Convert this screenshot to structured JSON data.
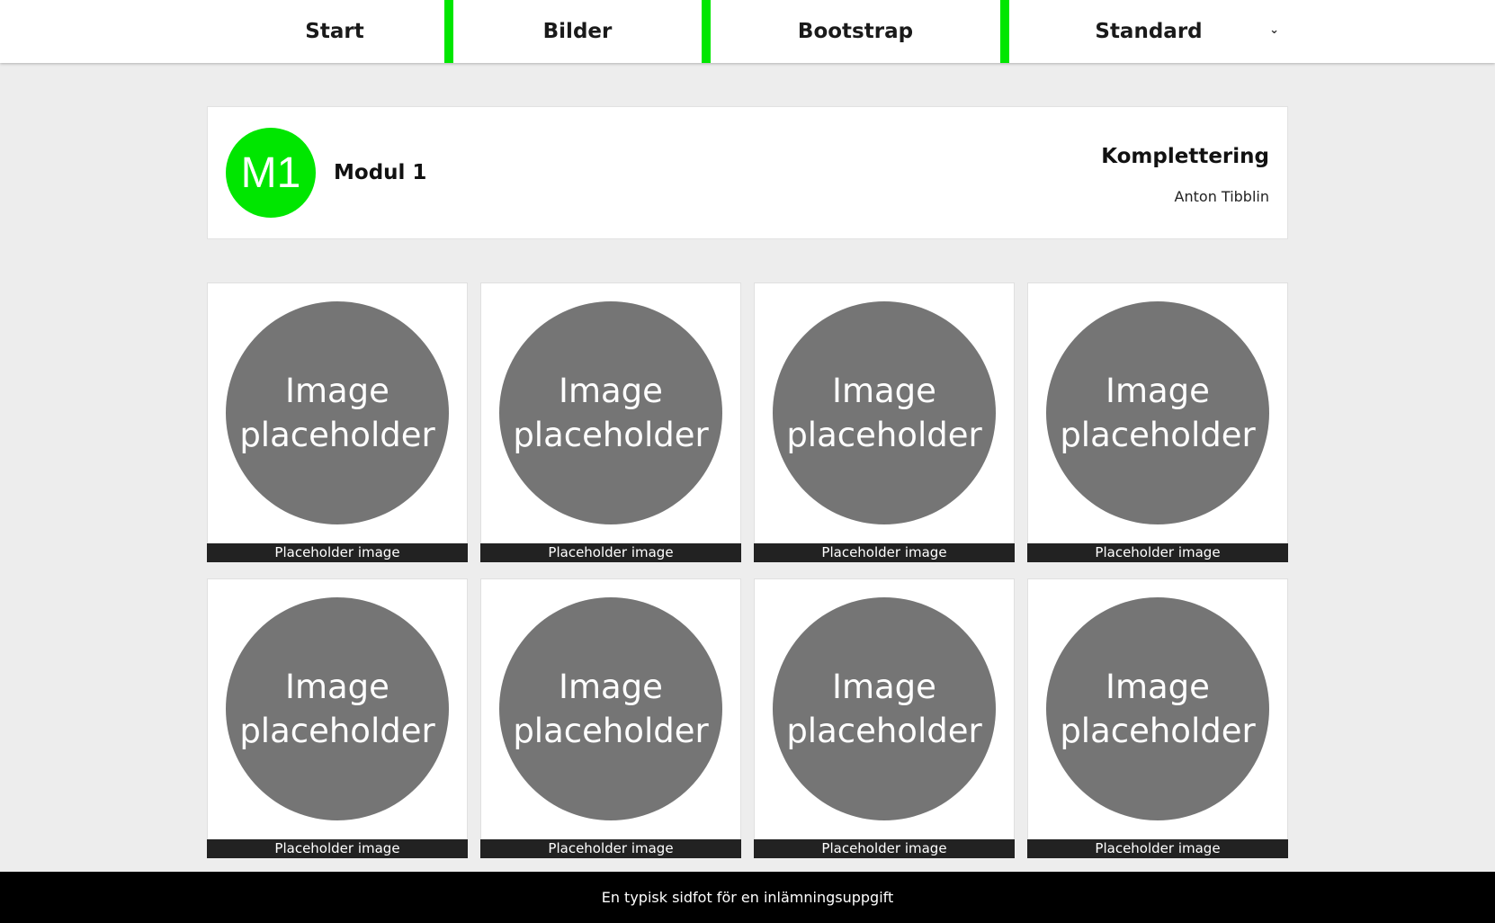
{
  "nav": {
    "items": [
      {
        "label": "Start"
      },
      {
        "label": "Bilder"
      },
      {
        "label": "Bootstrap"
      },
      {
        "label": "Standard",
        "dropdown_icon": "chevron-down-icon"
      }
    ],
    "separator_color": "#00e600"
  },
  "header": {
    "badge": "M1",
    "badge_color": "#00e600",
    "module": "Modul 1",
    "title": "Komplettering",
    "author": "Anton Tibblin"
  },
  "gallery": {
    "items": [
      {
        "placeholder_line1": "Image",
        "placeholder_line2": "placeholder",
        "caption": "Placeholder image"
      },
      {
        "placeholder_line1": "Image",
        "placeholder_line2": "placeholder",
        "caption": "Placeholder image"
      },
      {
        "placeholder_line1": "Image",
        "placeholder_line2": "placeholder",
        "caption": "Placeholder image"
      },
      {
        "placeholder_line1": "Image",
        "placeholder_line2": "placeholder",
        "caption": "Placeholder image"
      },
      {
        "placeholder_line1": "Image",
        "placeholder_line2": "placeholder",
        "caption": "Placeholder image"
      },
      {
        "placeholder_line1": "Image",
        "placeholder_line2": "placeholder",
        "caption": "Placeholder image"
      },
      {
        "placeholder_line1": "Image",
        "placeholder_line2": "placeholder",
        "caption": "Placeholder image"
      },
      {
        "placeholder_line1": "Image",
        "placeholder_line2": "placeholder",
        "caption": "Placeholder image"
      }
    ]
  },
  "footer": {
    "text": "En typisk sidfot för en inlämningsuppgift"
  }
}
